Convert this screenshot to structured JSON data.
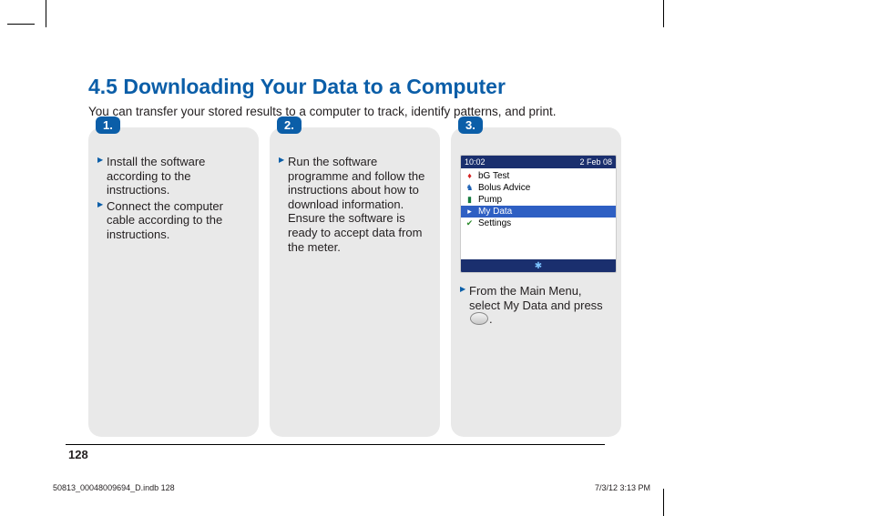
{
  "heading": "4.5 Downloading Your Data to a Computer",
  "intro": "You can transfer your stored results to a computer to track, identify patterns, and print.",
  "steps": [
    {
      "number": "1.",
      "bullets": [
        "Install the software according to the instructions.",
        "Connect the computer cable according to the instructions."
      ]
    },
    {
      "number": "2.",
      "bullets": [
        "Run the software programme and follow the instructions about how to download information. Ensure the software is ready to accept data from the meter."
      ]
    },
    {
      "number": "3.",
      "bullet_prefix": "From the Main Menu, select My Data and press ",
      "bullet_suffix": "."
    }
  ],
  "device": {
    "time": "10:02",
    "date": "2 Feb 08",
    "menu": [
      "bG Test",
      "Bolus Advice",
      "Pump",
      "My Data",
      "Settings"
    ],
    "selected_index": 3
  },
  "page_number": "128",
  "footer": {
    "left": "50813_00048009694_D.indb   128",
    "right": "7/3/12   3:13 PM"
  }
}
